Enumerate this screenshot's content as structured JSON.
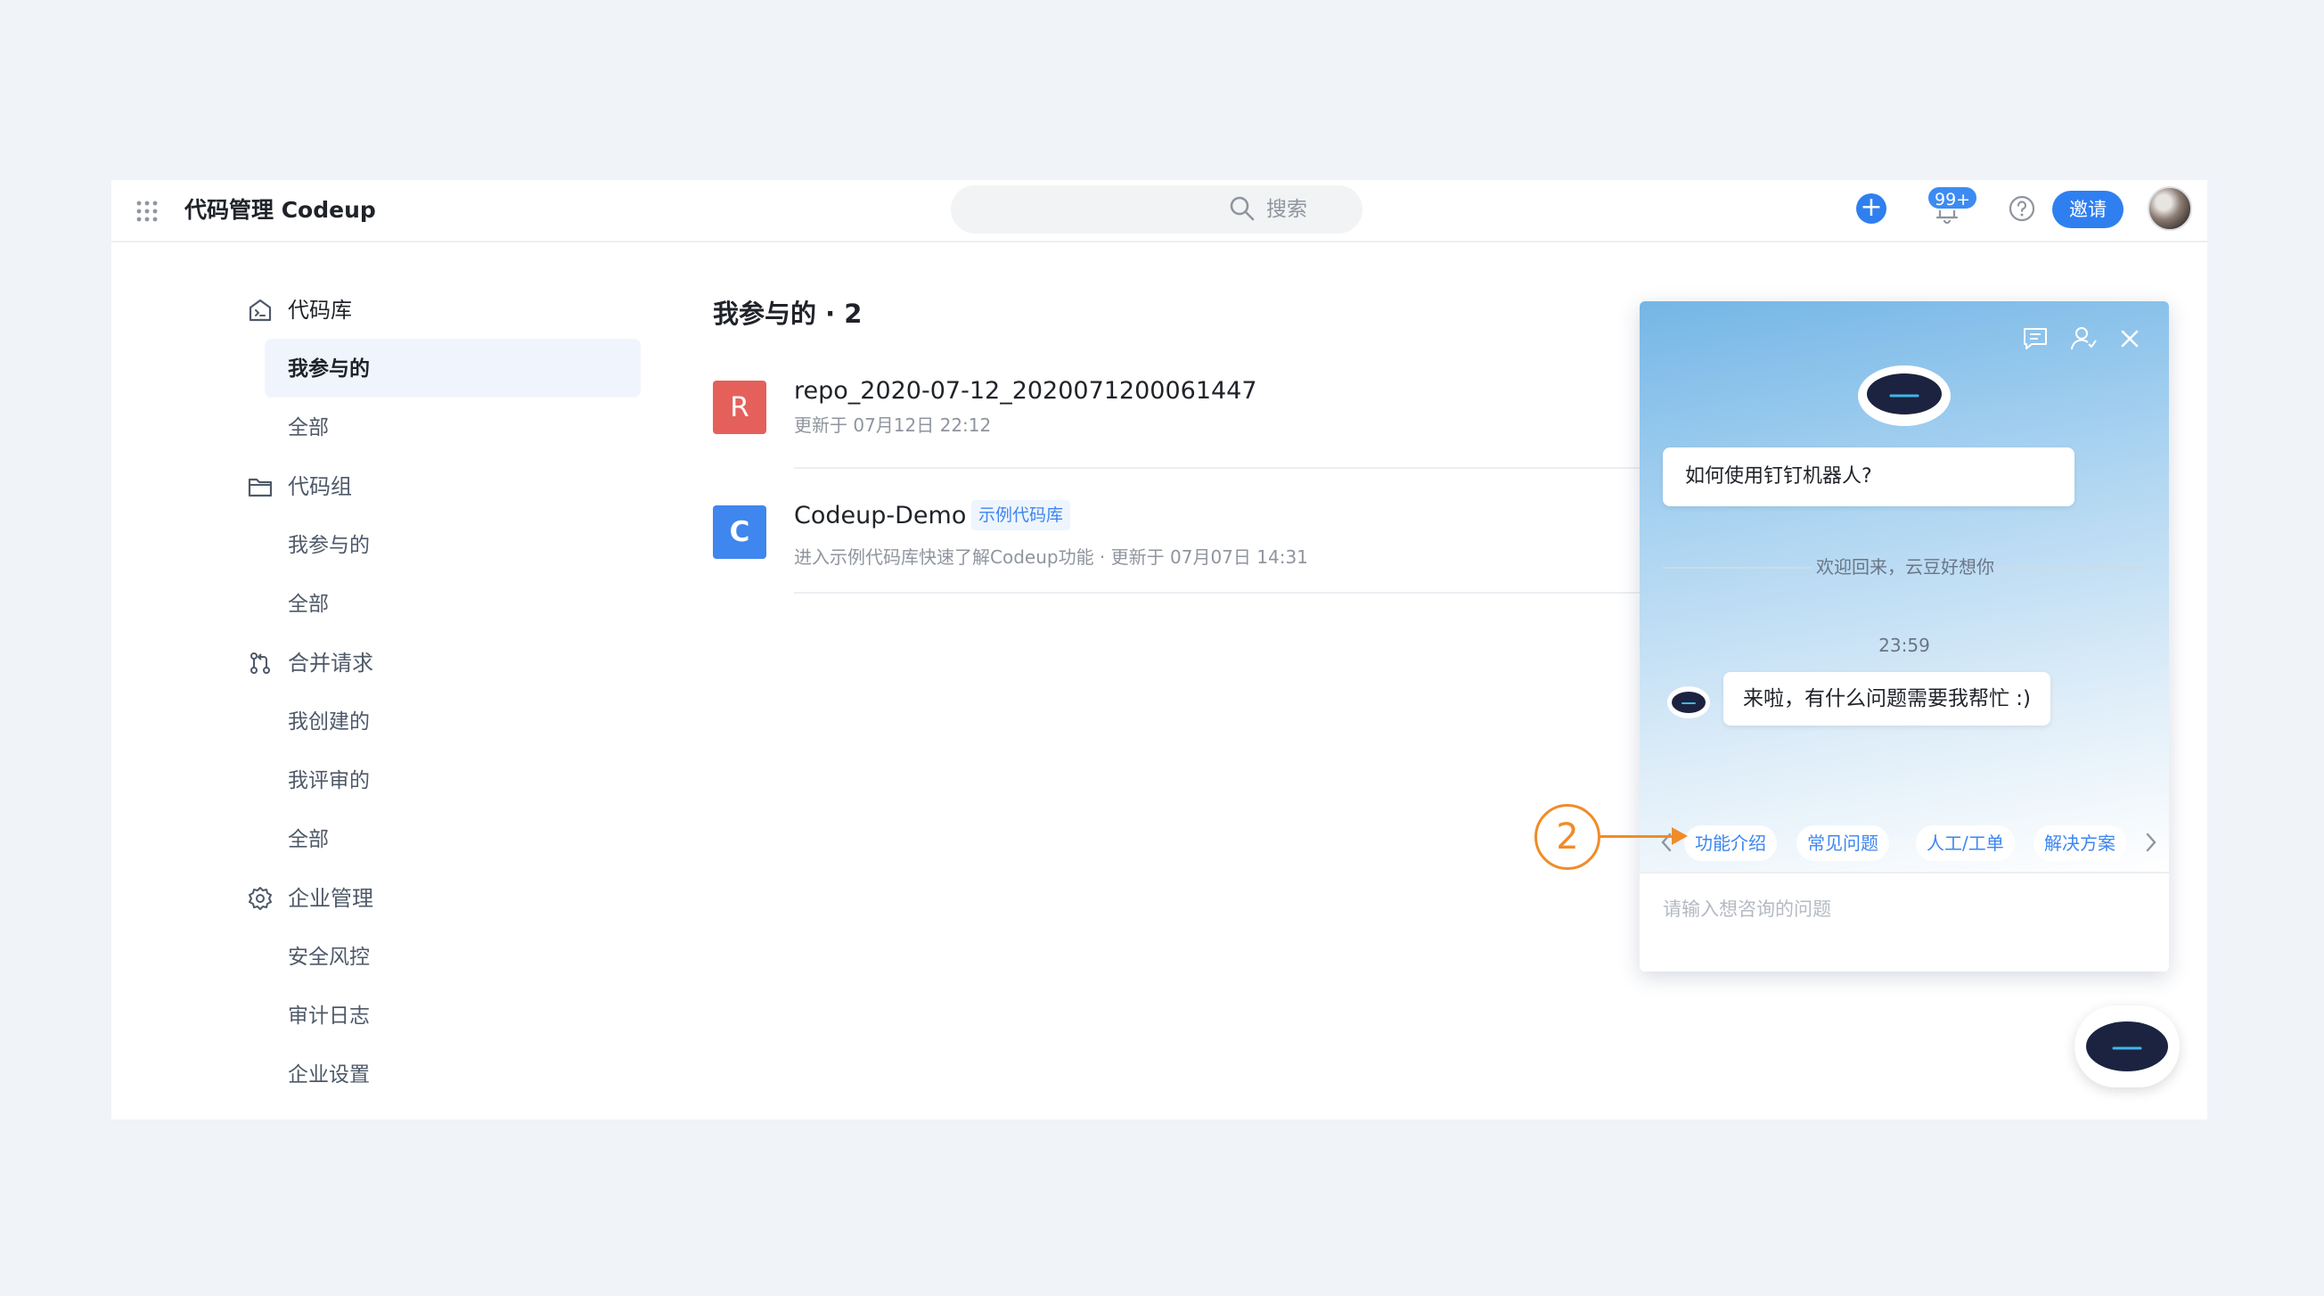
{
  "topbar": {
    "app_title": "代码管理 Codeup",
    "search_placeholder": "搜索",
    "plus_label": "+",
    "notification_badge": "99+",
    "invite_label": "邀请"
  },
  "sidebar": {
    "groups": [
      {
        "label": "代码库",
        "icon": "repo-icon",
        "items": [
          "我参与的",
          "全部"
        ]
      },
      {
        "label": "代码组",
        "icon": "folder-icon",
        "items": [
          "我参与的",
          "全部"
        ]
      },
      {
        "label": "合并请求",
        "icon": "merge-request-icon",
        "items": [
          "我创建的",
          "我评审的",
          "全部"
        ]
      },
      {
        "label": "企业管理",
        "icon": "gear-icon",
        "items": [
          "安全风控",
          "审计日志",
          "企业设置"
        ]
      }
    ],
    "active_item": "代码库 / 我参与的"
  },
  "main": {
    "title": "我参与的 · 2",
    "repos": [
      {
        "icon_letter": "R",
        "icon_color": "#e5605a",
        "name": "repo_2020-07-12_2020071200061447",
        "meta": "更新于 07月12日 22:12"
      },
      {
        "icon_letter": "C",
        "icon_color": "#3f86ef",
        "name": "Codeup-Demo",
        "tag": "示例代码库",
        "meta": "进入示例代码库快速了解Codeup功能  ·  更新于 07月07日 14:31"
      }
    ]
  },
  "chat": {
    "faq_question": "如何使用钉钉机器人?",
    "welcome": "欢迎回来，云豆好想你",
    "time": "23:59",
    "bot_message": "来啦，有什么问题需要我帮忙 :)",
    "quick_chips": [
      "功能介绍",
      "常见问题",
      "人工/工单",
      "解决方案"
    ],
    "input_placeholder": "请输入想咨询的问题"
  },
  "annotation": {
    "step_number": "2",
    "color": "#f08c28"
  },
  "colors": {
    "accent": "#2f7ff0",
    "background": "#f0f3f8"
  }
}
